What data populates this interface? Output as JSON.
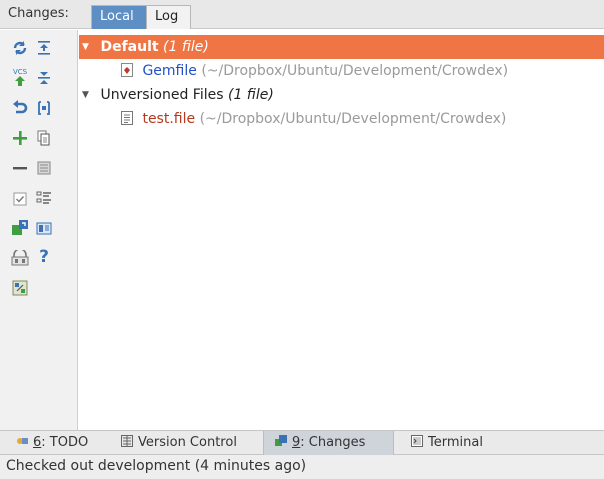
{
  "tabbar": {
    "caption": "Changes:",
    "tabs": [
      {
        "label": "Local"
      },
      {
        "label": "Log"
      }
    ]
  },
  "toolbar": {
    "icons": [
      "refresh-icon",
      "expand-all-icon",
      "vcs-commit-icon",
      "collapse-all-icon",
      "rollback-icon",
      "shelve-icon",
      "new-changelist-icon",
      "copy-icon",
      "remove-changelist-icon",
      "group-icon",
      "checkbox-icon",
      "show-diff-icon",
      "move-icon",
      "preview-icon",
      "lock-icon",
      "help-icon",
      "settings-icon"
    ]
  },
  "tree": {
    "default_group": {
      "name": "Default",
      "count": "(1 file)"
    },
    "default_file": {
      "name": "Gemfile",
      "path": "(~/Dropbox/Ubuntu/Development/Crowdex)"
    },
    "unversioned_group": {
      "name": "Unversioned Files",
      "count": "(1 file)"
    },
    "unversioned_file": {
      "name": "test.file",
      "path": "(~/Dropbox/Ubuntu/Development/Crowdex)"
    }
  },
  "bottombar": {
    "todo": {
      "num": "6",
      "label": ": TODO"
    },
    "version_control": {
      "label": "Version Control"
    },
    "changes": {
      "num": "9",
      "label": ": Changes"
    },
    "terminal": {
      "label": "Terminal"
    }
  },
  "status": {
    "text": "Checked out development (4 minutes ago)"
  },
  "colors": {
    "selection": "#f07544",
    "active_tab": "#5d8ec4",
    "modified_file": "#2350c6",
    "unversioned_file": "#b33a1e"
  }
}
